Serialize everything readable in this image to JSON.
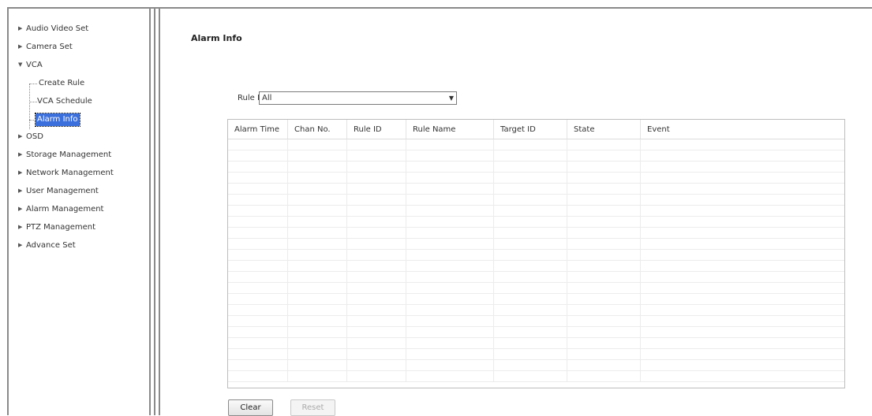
{
  "sidebar": {
    "items": [
      {
        "label": "Audio Video Set",
        "expanded": false
      },
      {
        "label": "Camera Set",
        "expanded": false
      },
      {
        "label": "VCA",
        "expanded": true
      },
      {
        "label": "OSD",
        "expanded": false
      },
      {
        "label": "Storage Management",
        "expanded": false
      },
      {
        "label": "Network Management",
        "expanded": false
      },
      {
        "label": "User Management",
        "expanded": false
      },
      {
        "label": "Alarm Management",
        "expanded": false
      },
      {
        "label": "PTZ Management",
        "expanded": false
      },
      {
        "label": "Advance Set",
        "expanded": false
      }
    ],
    "vca_children": [
      "Create Rule",
      "VCA Schedule",
      "Alarm Info"
    ],
    "selected": "Alarm Info"
  },
  "main": {
    "title": "Alarm Info",
    "rule_id_label": "Rule ID",
    "rule_id_value": "All",
    "columns": [
      "Alarm Time",
      "Chan No.",
      "Rule ID",
      "Rule Name",
      "Target ID",
      "State",
      "Event"
    ],
    "rows": []
  },
  "buttons": {
    "clear": "Clear",
    "reset": "Reset"
  },
  "colors": {
    "selection": "#3a6fdc",
    "frame": "#8a8a8a"
  }
}
